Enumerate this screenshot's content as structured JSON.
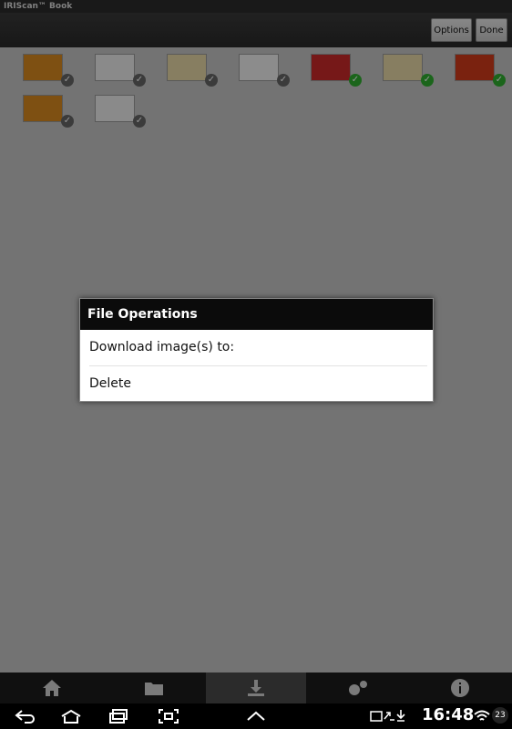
{
  "app": {
    "title": "IRIScan™ Book"
  },
  "toolbar": {
    "options_label": "Options",
    "done_label": "Done"
  },
  "thumbnails": [
    {
      "color": "#d98a1f",
      "check": "grey"
    },
    {
      "color": "#eeeeee",
      "check": "grey"
    },
    {
      "color": "#e8d9a8",
      "check": "grey"
    },
    {
      "color": "#f2f2f2",
      "check": "grey"
    },
    {
      "color": "#cc2a2a",
      "check": "green"
    },
    {
      "color": "#e8d9a8",
      "check": "green"
    },
    {
      "color": "#d33c1b",
      "check": "green"
    },
    {
      "color": "#d98a1f",
      "check": "grey"
    },
    {
      "color": "#eeeeee",
      "check": "grey"
    }
  ],
  "dialog": {
    "title": "File Operations",
    "items": [
      "Download image(s) to:",
      "Delete"
    ]
  },
  "bottombar": {
    "items": [
      "home-icon",
      "folder-icon",
      "download-icon",
      "settings-icon",
      "info-icon"
    ],
    "active_index": 2
  },
  "system": {
    "time": "16:48",
    "battery": "23"
  }
}
